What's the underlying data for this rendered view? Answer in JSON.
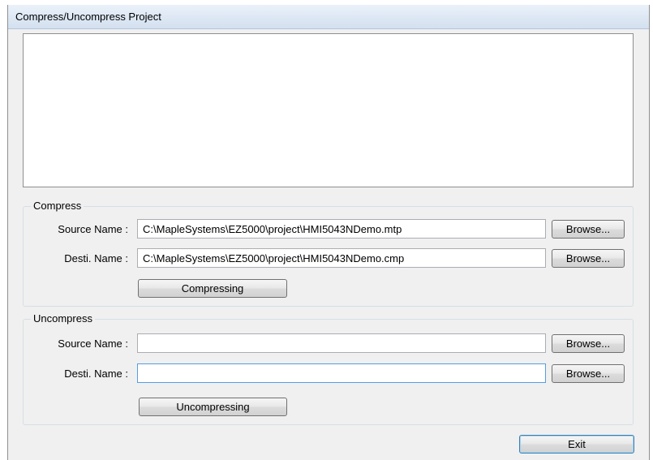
{
  "window": {
    "title": "Compress/Uncompress Project"
  },
  "compress": {
    "group_label": "Compress",
    "source_label": "Source Name :",
    "source_value": "C:\\MapleSystems\\EZ5000\\project\\HMI5043NDemo.mtp",
    "dest_label": "Desti. Name :",
    "dest_value": "C:\\MapleSystems\\EZ5000\\project\\HMI5043NDemo.cmp",
    "browse_label": "Browse...",
    "action_label": "Compressing"
  },
  "uncompress": {
    "group_label": "Uncompress",
    "source_label": "Source Name :",
    "source_value": "",
    "dest_label": "Desti. Name :",
    "dest_value": "",
    "browse_label": "Browse...",
    "action_label": "Uncompressing"
  },
  "footer": {
    "exit_label": "Exit"
  }
}
